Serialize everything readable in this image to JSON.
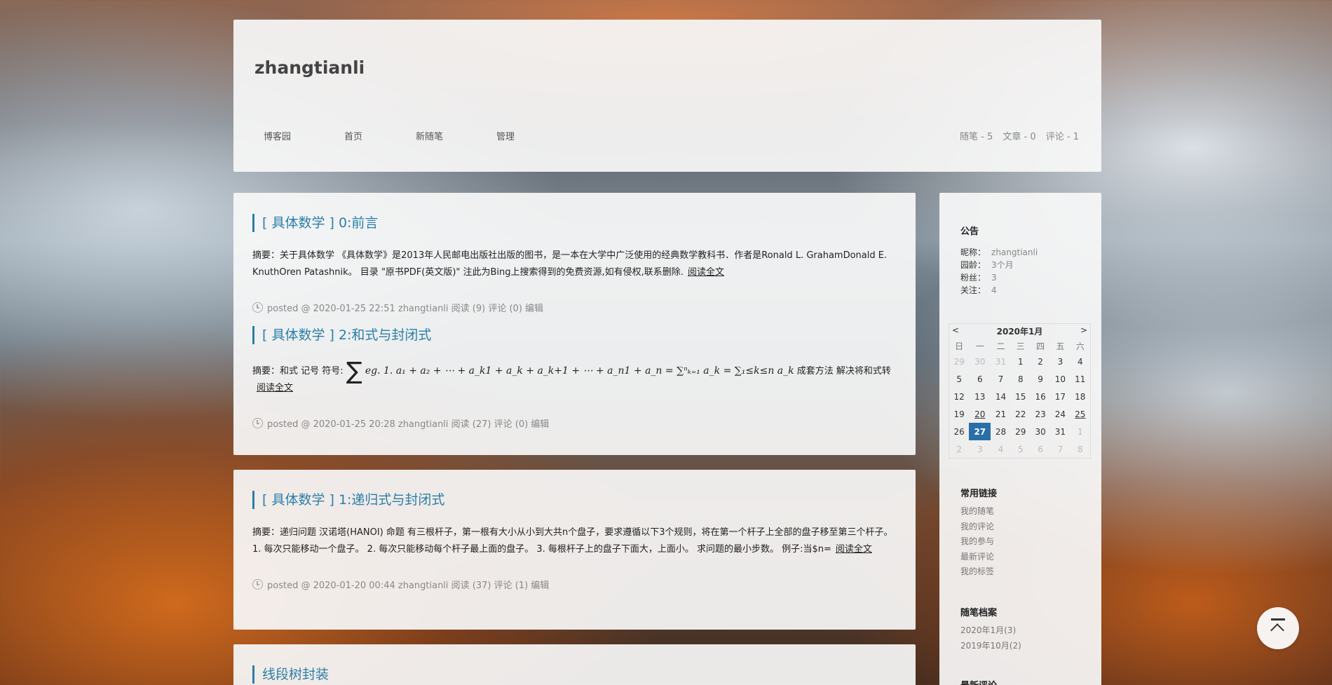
{
  "header": {
    "blog_title": "zhangtianli",
    "nav": [
      "博客园",
      "首页",
      "新随笔",
      "管理"
    ],
    "stats": [
      "随笔 - 5",
      "文章 - 0",
      "评论 - 1"
    ]
  },
  "posts": [
    {
      "title": "[ 具体数学 ] 0:前言",
      "summary": "摘要：关于具体数学 《具体数学》是2013年人民邮电出版社出版的图书，是一本在大学中广泛使用的经典数学教科书．作者是Ronald L. GrahamDonald E. KnuthOren Patashnik。 目录 \"原书PDF(英文版)\" 注此为Bing上搜索得到的免费资源,如有侵权,联系删除.",
      "read_more": "阅读全文",
      "meta": "posted @ 2020-01-25 22:51 zhangtianli 阅读 (9) 评论 (0) 编辑"
    },
    {
      "title": "[ 具体数学 ] 2:和式与封闭式",
      "summary_prefix": "摘要：和式 记号 符号:",
      "summary_sum_symbol": "∑",
      "summary_math": "eg. 1. a₁ + a₂ + ⋯ + a_k1 + a_k + a_k+1 + ⋯ + a_n1 + a_n = ∑ⁿₖ₌₁ a_k = ∑₁≤k≤n a_k",
      "summary_suffix": "成套方法 解决将和式转",
      "read_more": "阅读全文",
      "meta": "posted @ 2020-01-25 20:28 zhangtianli 阅读 (27) 评论 (0) 编辑"
    },
    {
      "title": "[ 具体数学 ] 1:递归式与封闭式",
      "summary": "摘要：递归问题 汉诺塔(HANOI) 命题 有三根杆子，第一根有大小从小到大共n个盘子，要求遵循以下3个规则，将在第一个杆子上全部的盘子移至第三个杆子。 1. 每次只能移动一个盘子。 2. 每次只能移动每个杆子最上面的盘子。 3. 每根杆子上的盘子下面大，上面小。 求问题的最小步数。 例子:当$n=",
      "read_more": "阅读全文",
      "meta": "posted @ 2020-01-20 00:44 zhangtianli 阅读 (37) 评论 (1) 编辑"
    },
    {
      "title": "线段树封装"
    }
  ],
  "sidebar": {
    "notice_title": "公告",
    "info": [
      {
        "k": "昵称：",
        "v": "zhangtianli"
      },
      {
        "k": "园龄：",
        "v": "3个月"
      },
      {
        "k": "粉丝：",
        "v": "3"
      },
      {
        "k": "关注：",
        "v": "4"
      }
    ],
    "calendar": {
      "prev": "<",
      "next": ">",
      "month": "2020年1月",
      "weekdays": [
        "日",
        "一",
        "二",
        "三",
        "四",
        "五",
        "六"
      ],
      "weeks": [
        [
          "29",
          "30",
          "31",
          "1",
          "2",
          "3",
          "4"
        ],
        [
          "5",
          "6",
          "7",
          "8",
          "9",
          "10",
          "11"
        ],
        [
          "12",
          "13",
          "14",
          "15",
          "16",
          "17",
          "18"
        ],
        [
          "19",
          "20",
          "21",
          "22",
          "23",
          "24",
          "25"
        ],
        [
          "26",
          "27",
          "28",
          "29",
          "30",
          "31",
          "1"
        ],
        [
          "2",
          "3",
          "4",
          "5",
          "6",
          "7",
          "8"
        ]
      ]
    },
    "links_title": "常用链接",
    "links": [
      "我的随笔",
      "我的评论",
      "我的参与",
      "最新评论",
      "我的标签"
    ],
    "archive_title": "随笔档案",
    "archive": [
      "2020年1月(3)",
      "2019年10月(2)"
    ],
    "recent_title": "最新评论"
  }
}
